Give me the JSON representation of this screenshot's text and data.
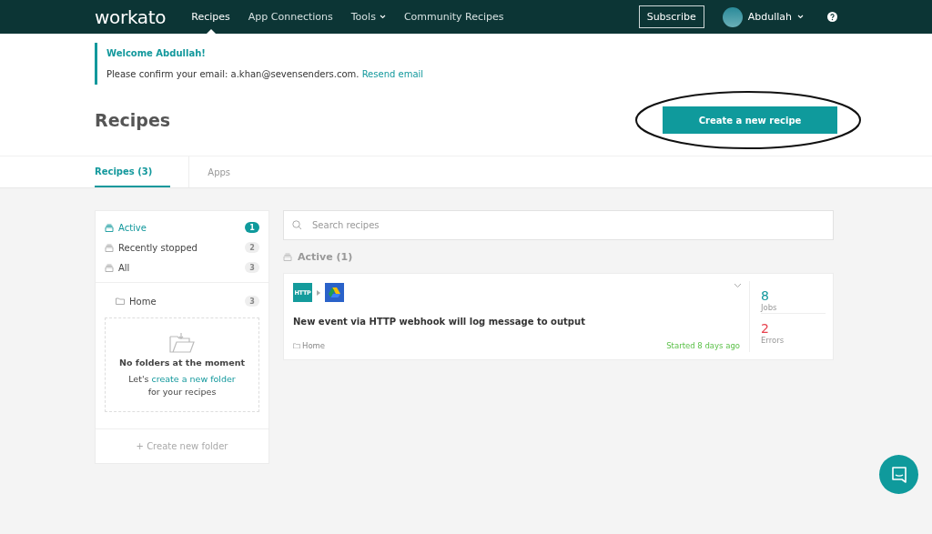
{
  "nav": {
    "logo": "workato",
    "items": [
      {
        "label": "Recipes",
        "selected": true,
        "dropdown": false
      },
      {
        "label": "App Connections",
        "selected": false,
        "dropdown": false
      },
      {
        "label": "Tools",
        "selected": false,
        "dropdown": true
      },
      {
        "label": "Community Recipes",
        "selected": false,
        "dropdown": false
      }
    ],
    "subscribe": "Subscribe",
    "user": "Abdullah"
  },
  "banner": {
    "title": "Welcome Abdullah!",
    "message": "Please confirm your email: a.khan@sevensenders.com.",
    "link": "Resend email"
  },
  "page": {
    "title": "Recipes",
    "create_button": "Create a new recipe"
  },
  "tabs": [
    {
      "label": "Recipes (3)",
      "selected": true
    },
    {
      "label": "Apps",
      "selected": false
    }
  ],
  "sidebar": {
    "filters": [
      {
        "label": "Active",
        "count": "1",
        "selected": true
      },
      {
        "label": "Recently stopped",
        "count": "2",
        "selected": false
      },
      {
        "label": "All",
        "count": "3",
        "selected": false
      }
    ],
    "folders": [
      {
        "label": "Home",
        "count": "3"
      }
    ],
    "empty": {
      "title": "No folders at the moment",
      "prefix": "Let's",
      "link": "create a new folder",
      "suffix": "for your recipes"
    },
    "create_folder": "+ Create new folder"
  },
  "search": {
    "placeholder": "Search recipes"
  },
  "section": {
    "title": "Active (1)"
  },
  "recipes": [
    {
      "trigger_app": "HTTP",
      "title": "New event via HTTP webhook will log message to output",
      "folder": "Home",
      "status": "Started 8 days ago",
      "jobs": "8",
      "jobs_label": "Jobs",
      "errors": "2",
      "errors_label": "Errors"
    }
  ]
}
